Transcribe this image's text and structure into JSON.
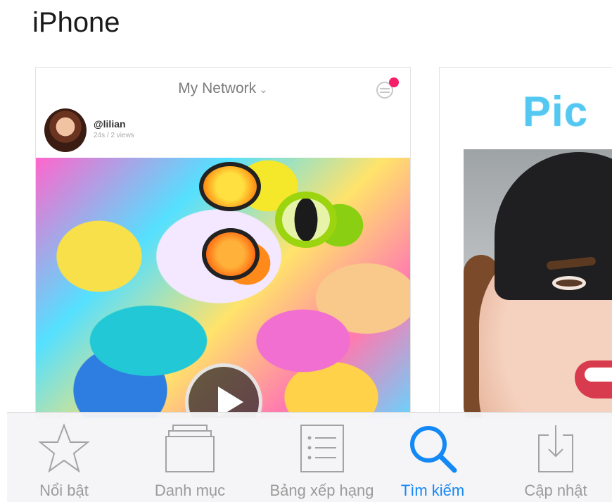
{
  "section": {
    "title": "iPhone"
  },
  "screenshot1": {
    "nav_title": "My Network",
    "user": "@lilian",
    "meta": "24s / 2 views"
  },
  "screenshot2": {
    "title": "Pic"
  },
  "tabbar": {
    "active_color": "#1488f5",
    "inactive_color": "#9b9b9b",
    "items": [
      {
        "label": "Nổi bật",
        "icon": "star-icon"
      },
      {
        "label": "Danh mục",
        "icon": "categories-icon"
      },
      {
        "label": "Bảng xếp hạng",
        "icon": "list-icon"
      },
      {
        "label": "Tìm kiếm",
        "icon": "search-icon",
        "active": true
      },
      {
        "label": "Cập nhật",
        "icon": "download-icon"
      }
    ]
  }
}
